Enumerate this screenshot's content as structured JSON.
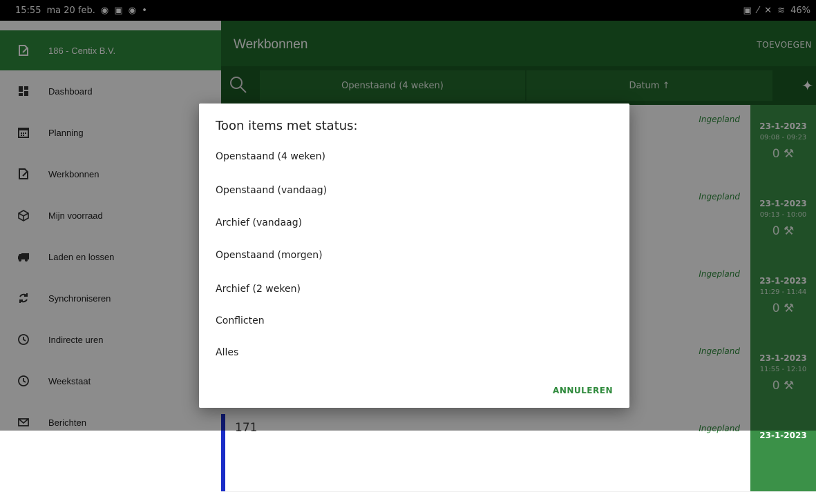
{
  "statusbar": {
    "time": "15:55",
    "date": "ma 20 feb.",
    "icons_left": "◉ ▣ ◉ •",
    "icons_right": "▣ ⁄ ✕ ≋",
    "battery": "46%"
  },
  "sidebar": {
    "items": [
      {
        "label": "186 - Centix B.V.",
        "icon": "edit-document-icon",
        "active": true
      },
      {
        "label": "Dashboard",
        "icon": "dashboard-icon"
      },
      {
        "label": "Planning",
        "icon": "calendar-icon"
      },
      {
        "label": "Werkbonnen",
        "icon": "edit-document-icon"
      },
      {
        "label": "Mijn voorraad",
        "icon": "box-icon"
      },
      {
        "label": "Laden en lossen",
        "icon": "truck-icon"
      },
      {
        "label": "Synchroniseren",
        "icon": "sync-icon"
      },
      {
        "label": "Indirecte uren",
        "icon": "clock-icon"
      },
      {
        "label": "Weekstaat",
        "icon": "clock-icon"
      },
      {
        "label": "Berichten",
        "icon": "mail-icon"
      }
    ]
  },
  "appbar": {
    "title": "Werkbonnen",
    "add_label": "TOEVOEGEN"
  },
  "filterbar": {
    "status_filter": "Openstaand (4 weken)",
    "sort": "Datum ↑"
  },
  "rows": [
    {
      "status": "Ingepland",
      "date": "23-1-2023",
      "time": "09:08 - 09:23",
      "count": "0"
    },
    {
      "status": "Ingepland",
      "date": "23-1-2023",
      "time": "09:13 - 10:00",
      "count": "0"
    },
    {
      "status": "Ingepland",
      "date": "23-1-2023",
      "time": "11:29 - 11:44",
      "count": "0"
    },
    {
      "status": "Ingepland",
      "date": "23-1-2023",
      "time": "11:55 - 12:10",
      "count": "0"
    },
    {
      "number": "171",
      "status": "Ingepland",
      "date": "23-1-2023",
      "time": "",
      "count": ""
    }
  ],
  "dialog": {
    "title": "Toon items met status:",
    "options": [
      "Openstaand (4 weken)",
      "Openstaand (vandaag)",
      "Archief (vandaag)",
      "Openstaand (morgen)",
      "Archief (2 weken)",
      "Conflicten",
      "Alles"
    ],
    "cancel_label": "ANNULEREN"
  },
  "colors": {
    "primary": "#1f6a2a",
    "accent": "#2f8a3c",
    "row_marker": "#1a2dc8"
  }
}
